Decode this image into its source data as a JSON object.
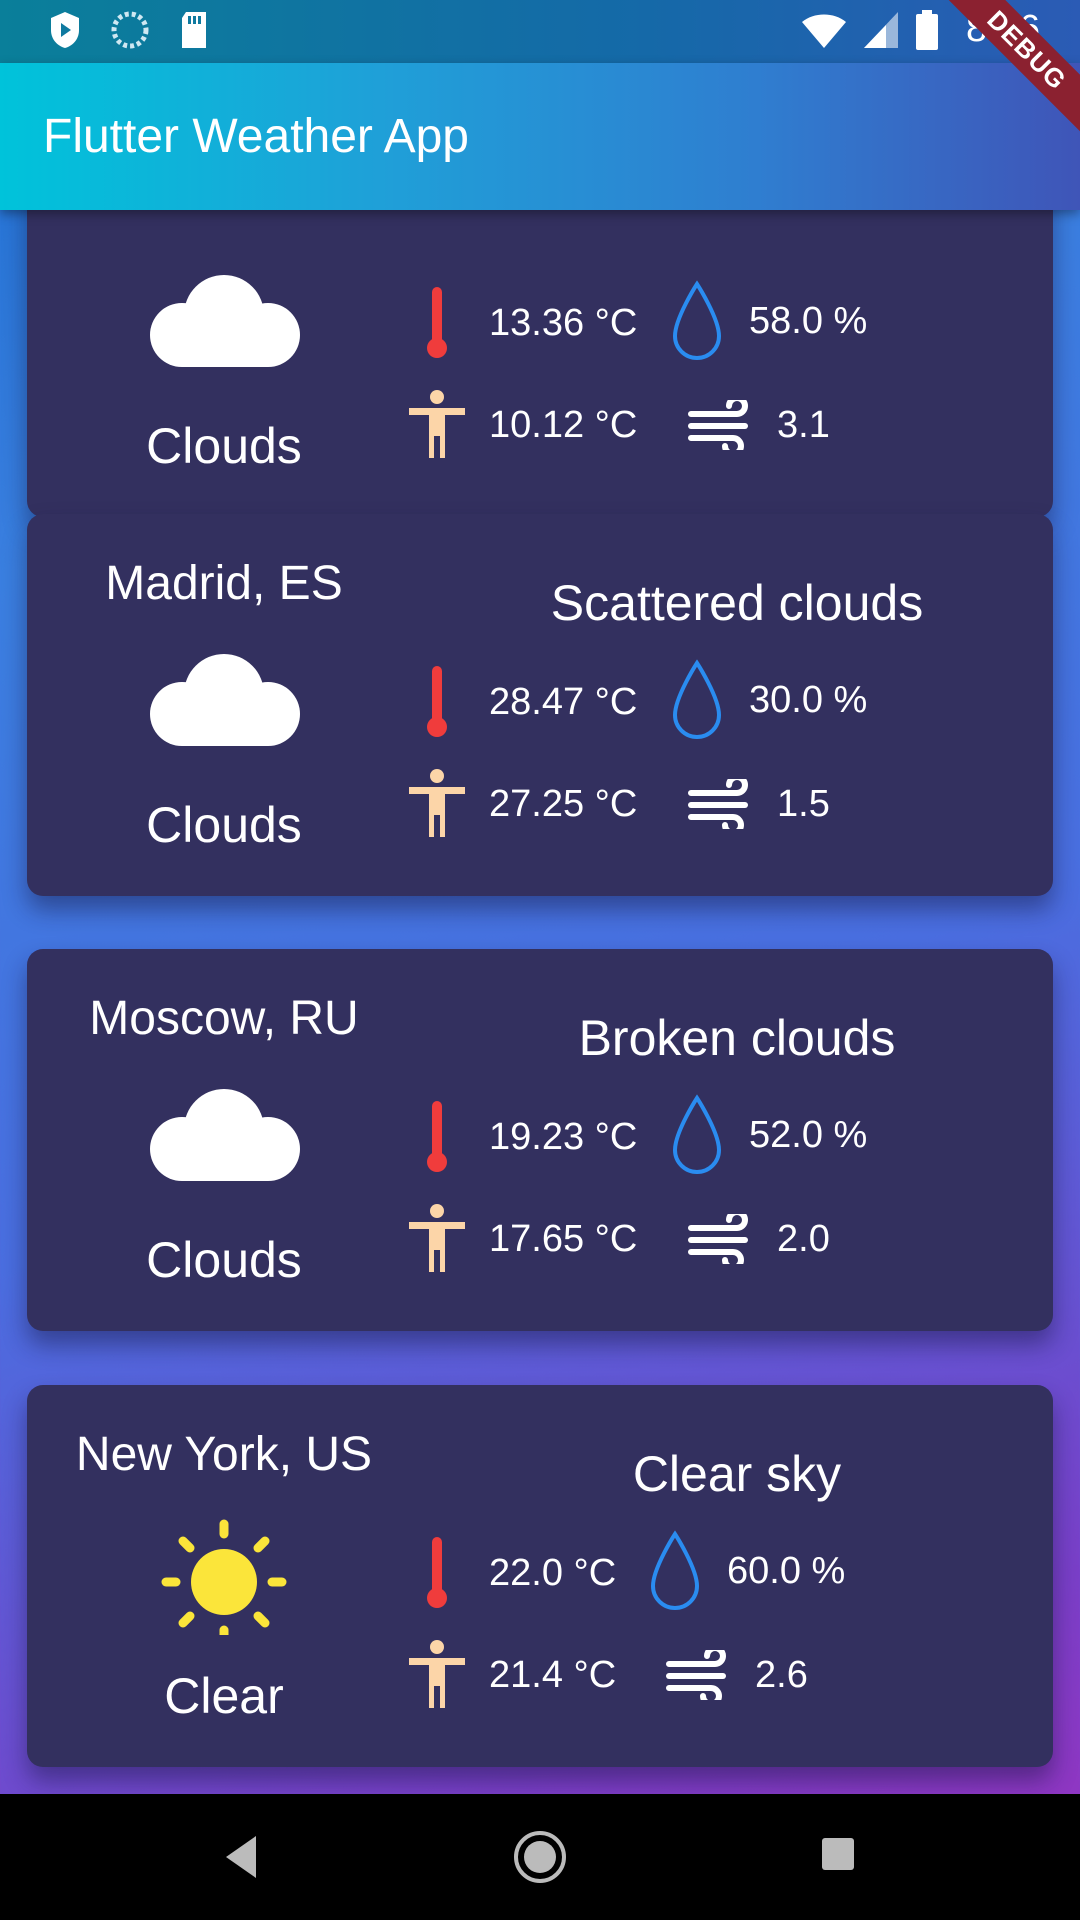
{
  "app": {
    "title": "Flutter Weather App",
    "debug_banner": "DEBUG"
  },
  "status_bar": {
    "time": "8:36"
  },
  "colors": {
    "card": "#33305f",
    "temp": "#f03c3c",
    "humidity": "#2a8cf0",
    "feels": "#fcd5a8",
    "sun": "#fbe53a"
  },
  "cards": [
    {
      "city": "",
      "description": "",
      "icon": "cloud-icon",
      "condition": "Clouds",
      "temp": "13.36 °C",
      "humidity": "58.0 %",
      "feels_like": "10.12 °C",
      "wind": "3.1"
    },
    {
      "city": "Madrid, ES",
      "description": "Scattered clouds",
      "icon": "cloud-icon",
      "condition": "Clouds",
      "temp": "28.47 °C",
      "humidity": "30.0 %",
      "feels_like": "27.25 °C",
      "wind": "1.5"
    },
    {
      "city": "Moscow, RU",
      "description": "Broken clouds",
      "icon": "cloud-icon",
      "condition": "Clouds",
      "temp": "19.23 °C",
      "humidity": "52.0 %",
      "feels_like": "17.65 °C",
      "wind": "2.0"
    },
    {
      "city": "New York, US",
      "description": "Clear sky",
      "icon": "sun-icon",
      "condition": "Clear",
      "temp": "22.0 °C",
      "humidity": "60.0 %",
      "feels_like": "21.4 °C",
      "wind": "2.6"
    }
  ]
}
